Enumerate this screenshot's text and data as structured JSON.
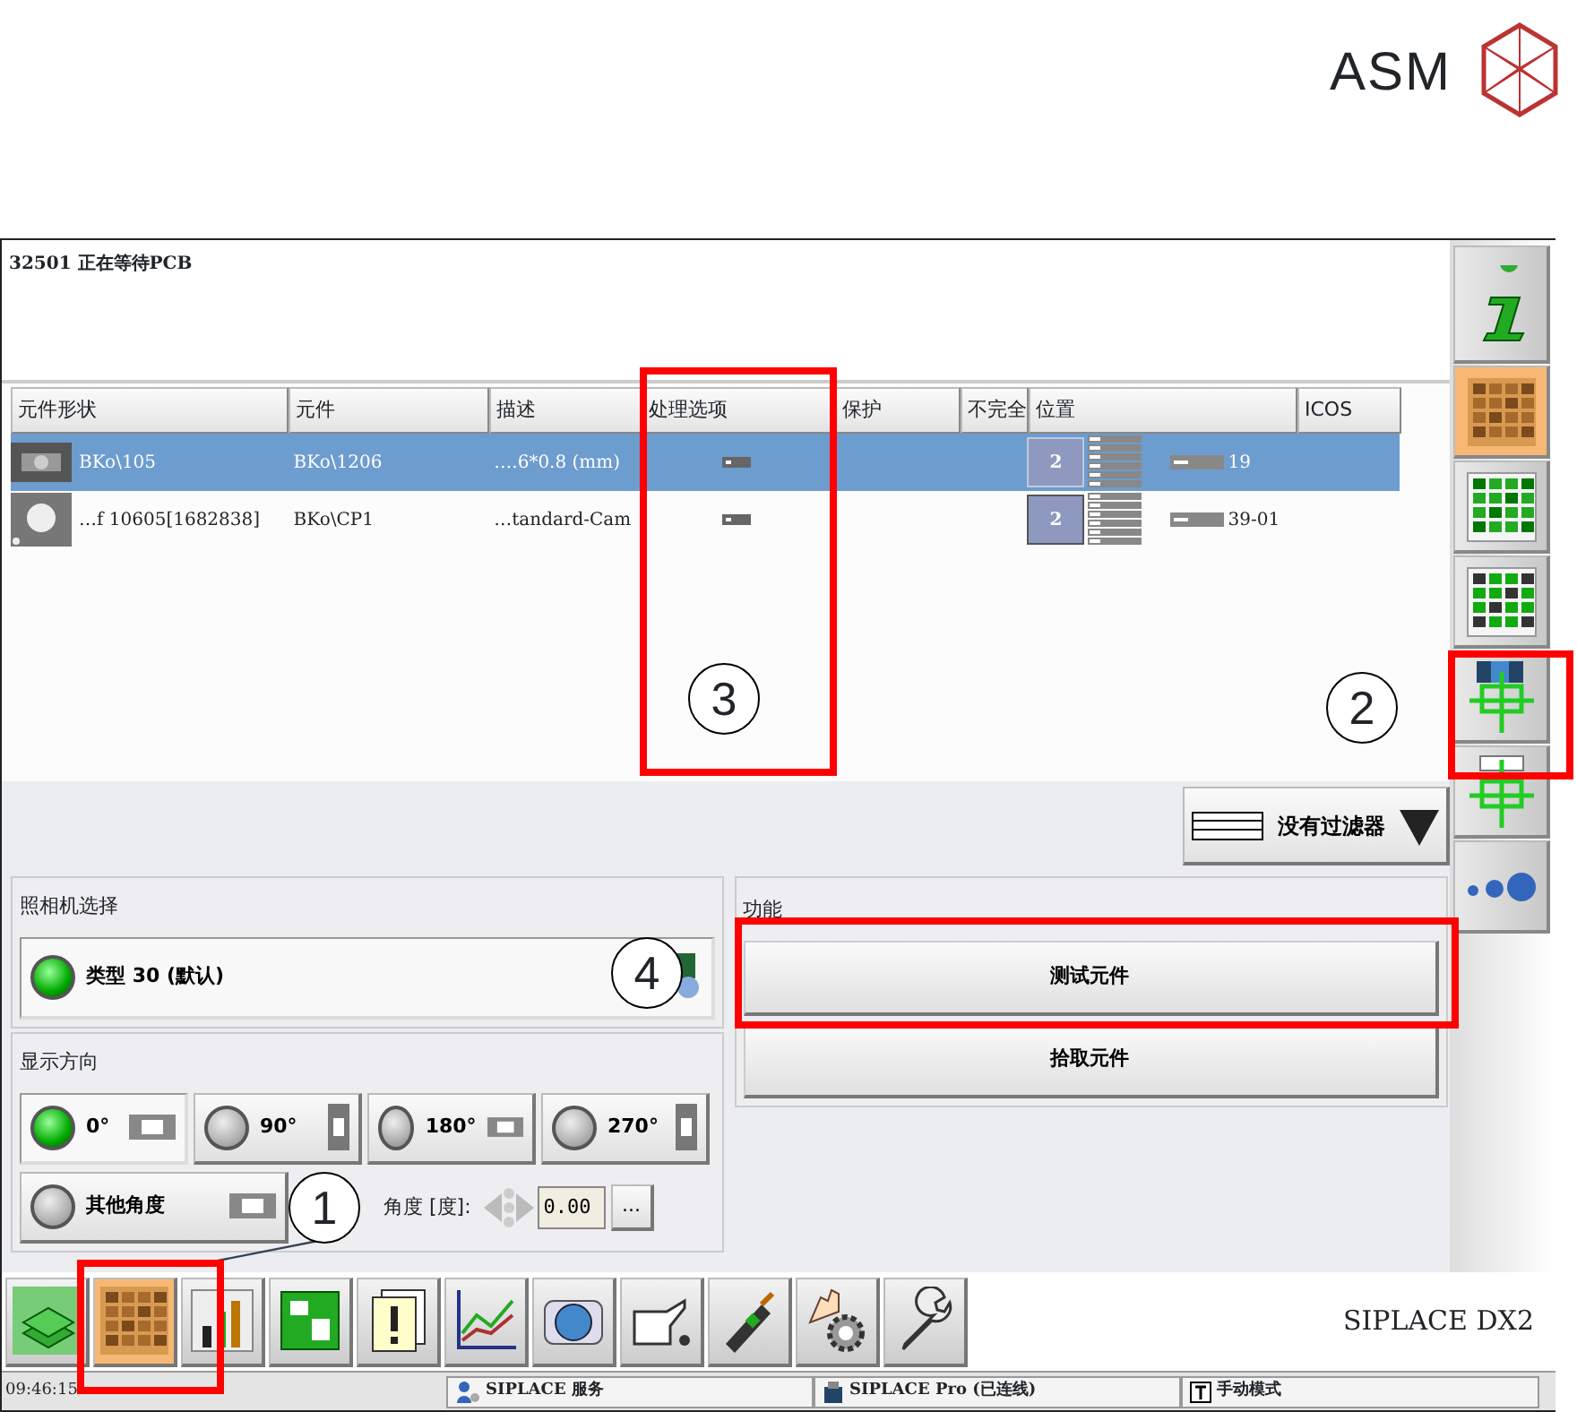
{
  "slide": {
    "logo": "ASM"
  },
  "status_message": "32501 正在等待PCB",
  "table": {
    "columns": [
      "元件形状",
      "元件",
      "描述",
      "处理选项",
      "保护",
      "不完全",
      "位置",
      "ICOS"
    ],
    "rows": [
      {
        "selected": true,
        "shape": "BKo\\105",
        "component": "BKo\\1206",
        "description": "….6*0.8 (mm)",
        "slot": "2",
        "location": "19"
      },
      {
        "selected": false,
        "shape": "…f 10605[1682838]",
        "component": "BKo\\CP1",
        "description": "…tandard-Cam",
        "slot": "2",
        "location": "39-01"
      }
    ]
  },
  "filter_button": {
    "label": "没有过滤器"
  },
  "camera_selection": {
    "title": "照相机选择",
    "option": {
      "label": "类型 30 (默认)",
      "selected": true
    }
  },
  "display_direction": {
    "title": "显示方向",
    "options": [
      {
        "label": "0°",
        "selected": true,
        "kind": "horizontal"
      },
      {
        "label": "90°",
        "selected": false,
        "kind": "vertical"
      },
      {
        "label": "180°",
        "selected": false,
        "kind": "horizontal"
      },
      {
        "label": "270°",
        "selected": false,
        "kind": "vertical"
      },
      {
        "label": "其他角度",
        "selected": false,
        "kind": "horizontal"
      }
    ],
    "angle_label": "角度 [度]:",
    "angle_value": "0.00",
    "more_button": "..."
  },
  "functions": {
    "title": "功能",
    "buttons": [
      "测试元件",
      "拾取元件"
    ]
  },
  "sidebar": {
    "items": [
      {
        "selected": false
      },
      {
        "selected": true
      },
      {
        "selected": false
      },
      {
        "selected": false
      },
      {
        "selected": false
      },
      {
        "selected": false
      },
      {
        "selected": false
      }
    ]
  },
  "toolbar": {
    "items": [
      {
        "selected": false
      },
      {
        "selected": true
      },
      {
        "selected": false
      },
      {
        "selected": false
      },
      {
        "selected": false
      },
      {
        "selected": false
      },
      {
        "selected": false
      },
      {
        "selected": false
      },
      {
        "selected": false
      },
      {
        "selected": false
      },
      {
        "selected": false
      }
    ],
    "product": "SIPLACE DX2"
  },
  "status_bar": {
    "time": "09:46:15",
    "items": [
      {
        "label": "SIPLACE 服务"
      },
      {
        "label": "SIPLACE Pro (已连线)"
      },
      {
        "label": "手动模式"
      }
    ]
  },
  "annotations": [
    {
      "number": "1"
    },
    {
      "number": "2"
    },
    {
      "number": "3"
    },
    {
      "number": "4"
    }
  ]
}
